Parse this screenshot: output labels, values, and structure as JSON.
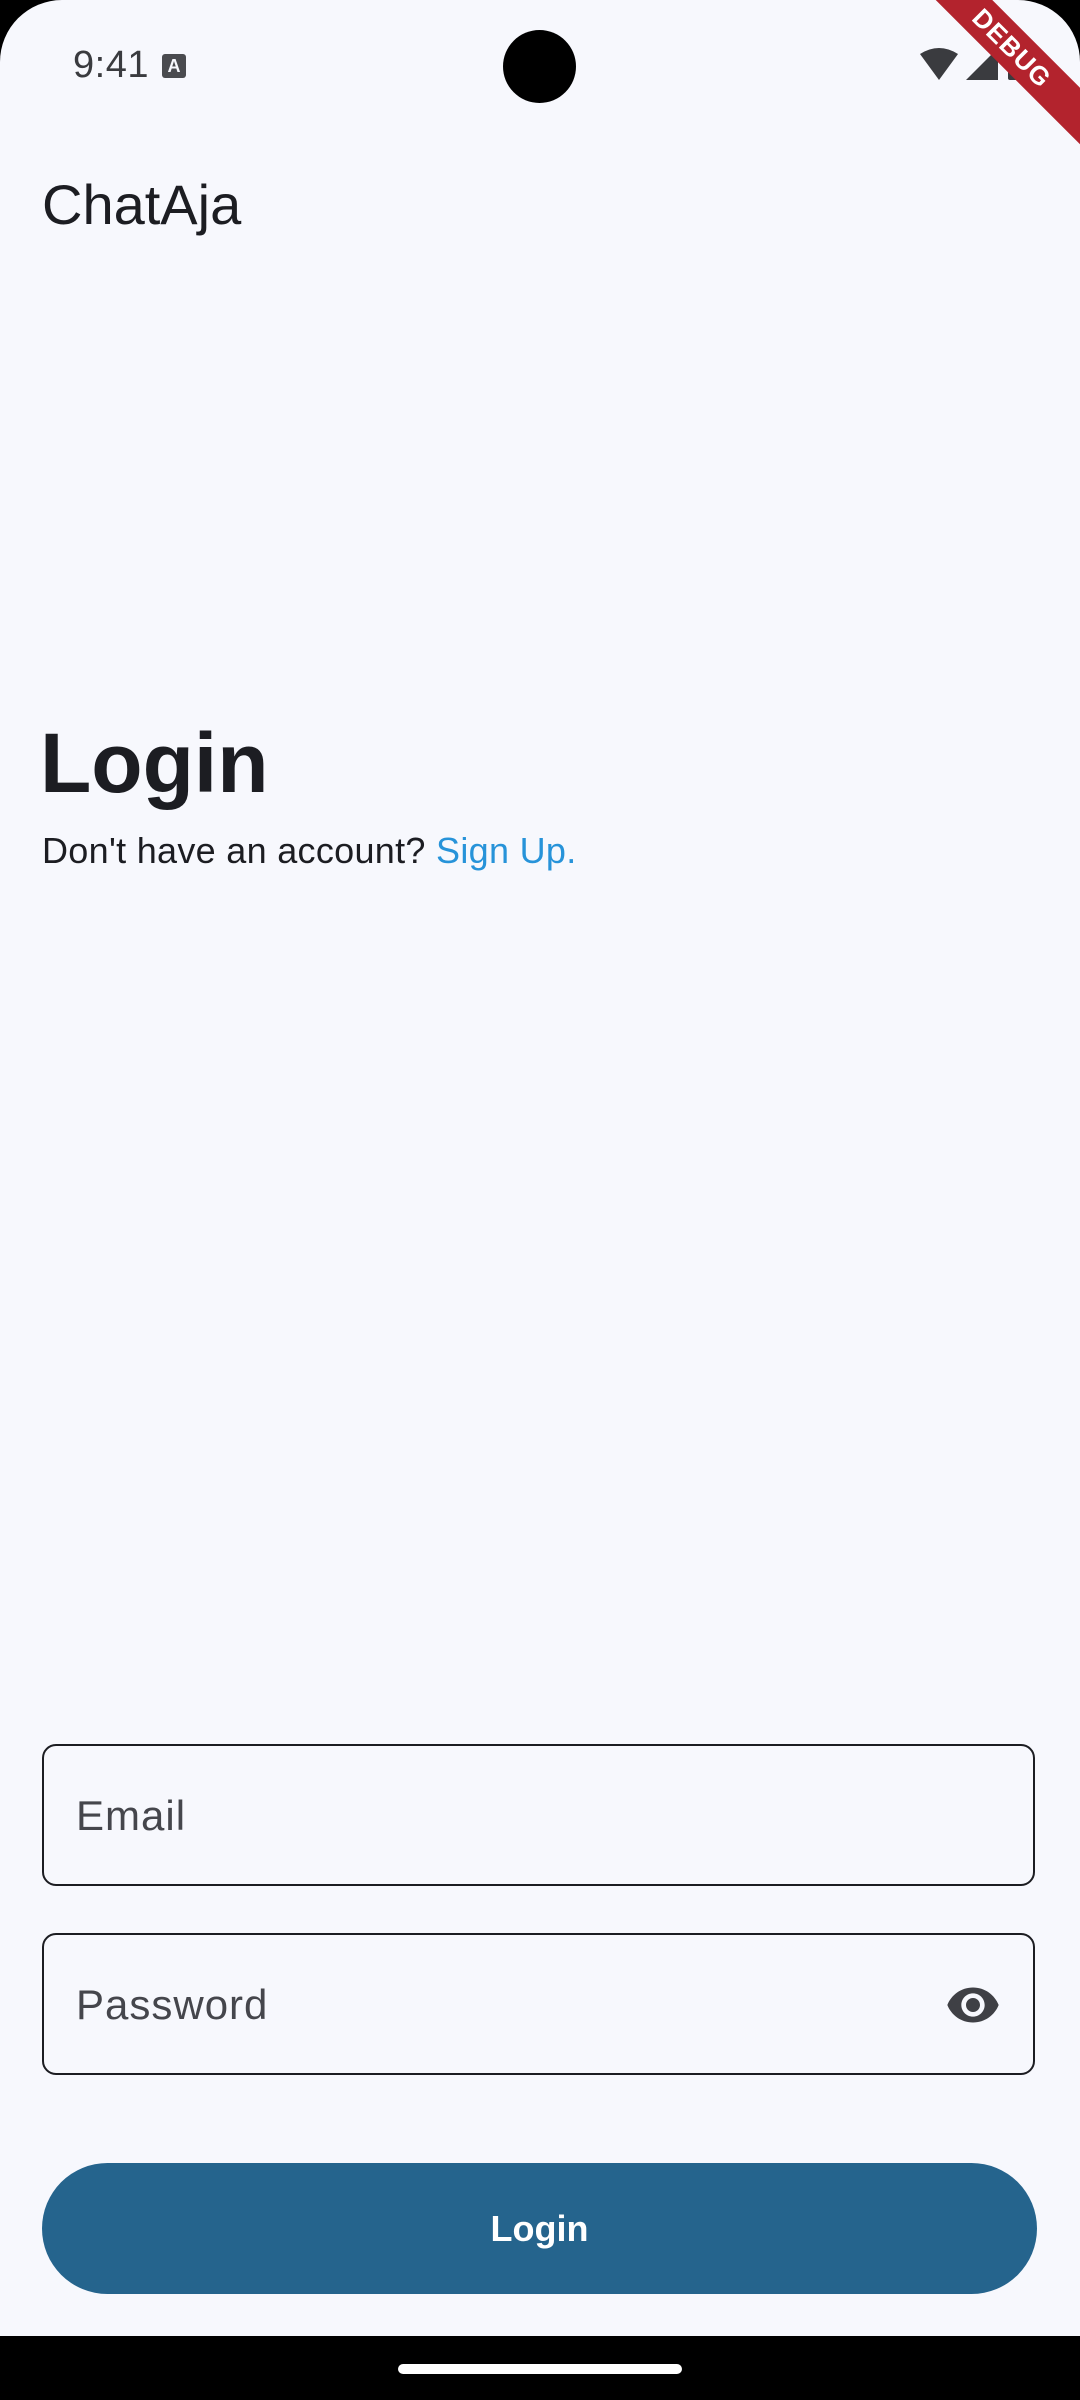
{
  "status_bar": {
    "time": "9:41",
    "keyboard_indicator": "A",
    "icons": [
      "wifi-icon",
      "signal-icon",
      "battery-icon"
    ]
  },
  "debug_banner": "DEBUG",
  "app_bar": {
    "title": "ChatAja"
  },
  "login": {
    "heading": "Login",
    "prompt": "Don't have an account? ",
    "signup_link": "Sign Up."
  },
  "form": {
    "email_placeholder": "Email",
    "email_value": "",
    "password_placeholder": "Password",
    "password_value": "",
    "password_toggle_icon": "eye-icon",
    "submit_label": "Login"
  },
  "colors": {
    "background": "#f7f8fd",
    "primary": "#25648d",
    "link": "#2793d9",
    "text": "#1c1d22",
    "debug": "#b3232d"
  }
}
